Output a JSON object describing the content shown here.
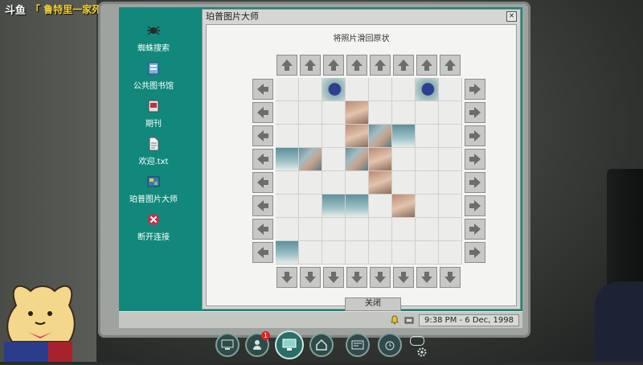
{
  "stream": {
    "logo": "斗鱼",
    "title": "「 鲁特里一家死了 」- Steam"
  },
  "desktop": {
    "icons": [
      {
        "name": "spider-icon",
        "label": "蜘蛛搜索"
      },
      {
        "name": "library-icon",
        "label": "公共图书馆"
      },
      {
        "name": "journal-icon",
        "label": "期刊"
      },
      {
        "name": "txt-file-icon",
        "label": "欢迎.txt"
      },
      {
        "name": "photo-master-icon",
        "label": "珀普图片大师"
      },
      {
        "name": "disconnect-icon",
        "label": "断开连接"
      }
    ]
  },
  "dialog": {
    "title": "珀普图片大师",
    "close_glyph": "×",
    "instruction": "将照片滑回原状",
    "close_button": "关闭"
  },
  "puzzle": {
    "rows": [
      [
        "e",
        "e",
        "cap",
        "e",
        "e",
        "e",
        "cap",
        "e"
      ],
      [
        "e",
        "e",
        "e",
        "skin",
        "e",
        "e",
        "e",
        "e"
      ],
      [
        "e",
        "e",
        "e",
        "skin",
        "img",
        "pool",
        "e",
        "e"
      ],
      [
        "pool",
        "img",
        "e",
        "img",
        "skin",
        "e",
        "e",
        "e"
      ],
      [
        "e",
        "e",
        "e",
        "e",
        "skin",
        "e",
        "e",
        "e"
      ],
      [
        "e",
        "e",
        "pool",
        "pool",
        "e",
        "skin",
        "e",
        "e"
      ],
      [
        "e",
        "e",
        "e",
        "e",
        "e",
        "e",
        "e",
        "e"
      ],
      [
        "pool",
        "e",
        "e",
        "e",
        "e",
        "e",
        "e",
        "e"
      ]
    ]
  },
  "taskbar": {
    "clock": "9:38 PM - 6 Dec, 1998"
  },
  "dock": {
    "badge_count": "1"
  },
  "colors": {
    "desktop": "#12887c",
    "dialog": "#d6d7d4",
    "accent": "#f4d23a"
  }
}
